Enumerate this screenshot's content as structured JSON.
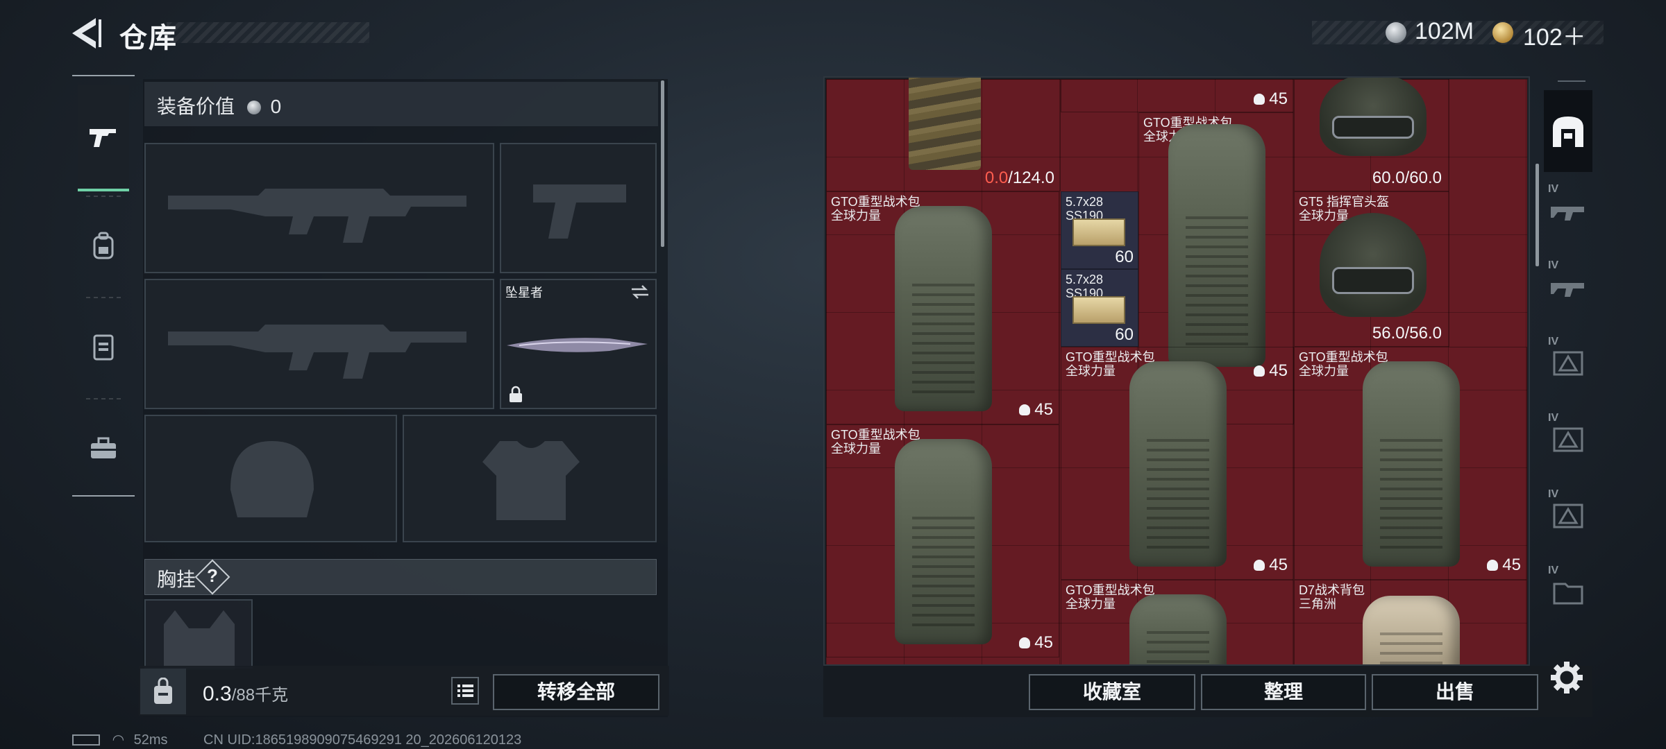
{
  "header": {
    "title": "仓库",
    "currency_silver": "102M",
    "currency_gold": "102＋"
  },
  "left_tabs": [
    "gun-icon",
    "backpack-icon",
    "vest-icon",
    "toolbox-icon"
  ],
  "loadout": {
    "gear_value_label": "装备价值",
    "gear_value": "0",
    "melee_name": "坠星者",
    "chest_rig_label": "胸挂",
    "help": "?"
  },
  "weight": {
    "current": "0.3",
    "max": "/88千克"
  },
  "transfer_all": "转移全部",
  "status": {
    "ping": "52ms",
    "uid": "CN UID:1865198909075469291 20_202606120123"
  },
  "stash": {
    "cell_top_qty": "45",
    "armor_top_durability_current": "0.0",
    "armor_top_durability_max": "/124.0",
    "helmet_top_durability": "60.0/60.0",
    "items": {
      "bp_top_center": {
        "name": "GTO重型战术包",
        "sub": "全球力量"
      },
      "bp_left1": {
        "name": "GTO重型战术包",
        "sub": "全球力量",
        "qty": "45"
      },
      "ammo1": {
        "name": "5.7x28",
        "sub": "SS190",
        "qty": "60"
      },
      "ammo2": {
        "name": "5.7x28",
        "sub": "SS190",
        "qty": "60"
      },
      "bp_center_qty": "45",
      "helmet_gt5": {
        "name": "GT5 指挥官头盔",
        "sub": "全球力量",
        "durability": "56.0/56.0"
      },
      "bp_mid1": {
        "name": "GTO重型战术包",
        "sub": "全球力量",
        "qty": "45"
      },
      "bp_mid2": {
        "name": "GTO重型战术包",
        "sub": "全球力量",
        "qty": "45"
      },
      "bp_left2": {
        "name": "GTO重型战术包",
        "sub": "全球力量",
        "qty": "45"
      },
      "bp_bottom1": {
        "name": "GTO重型战术包",
        "sub": "全球力量"
      },
      "bp_d7": {
        "name": "D7战术背包",
        "sub": "三角洲"
      }
    }
  },
  "stash_buttons": {
    "collection": "收藏室",
    "organize": "整理",
    "sell": "出售"
  },
  "right_tabs": [
    {
      "level": ""
    },
    {
      "level": "IV"
    },
    {
      "level": "IV"
    },
    {
      "level": "IV"
    },
    {
      "level": "IV"
    },
    {
      "level": "IV"
    },
    {
      "level": "IV"
    }
  ]
}
